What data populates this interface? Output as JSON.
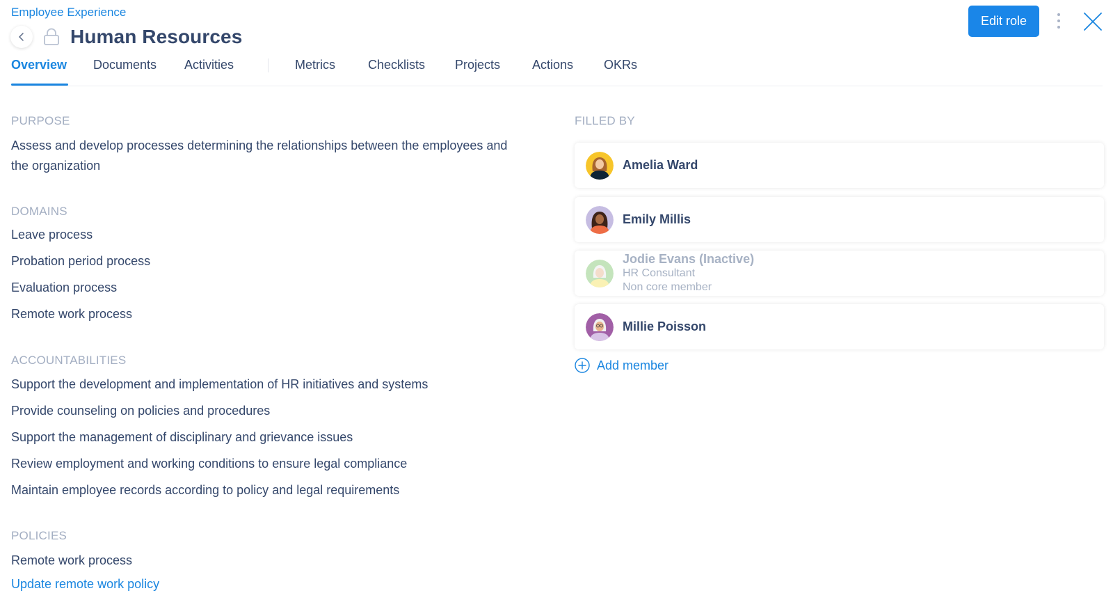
{
  "header": {
    "breadcrumb": "Employee Experience",
    "title": "Human Resources",
    "edit_label": "Edit role",
    "icons": {
      "back": "chevron-left-icon",
      "lock": "lock-icon",
      "more": "vertical-dots-icon",
      "close": "close-icon"
    }
  },
  "tabs": [
    {
      "label": "Overview",
      "active": true
    },
    {
      "label": "Documents",
      "active": false
    },
    {
      "label": "Activities",
      "active": false
    },
    {
      "label": "Metrics",
      "active": false
    },
    {
      "label": "Checklists",
      "active": false
    },
    {
      "label": "Projects",
      "active": false
    },
    {
      "label": "Actions",
      "active": false
    },
    {
      "label": "OKRs",
      "active": false
    }
  ],
  "purpose": {
    "label": "PURPOSE",
    "text": "Assess and develop processes determining the relationships between the employees and the organization"
  },
  "domains": {
    "label": "DOMAINS",
    "items": [
      "Leave process",
      "Probation period process",
      "Evaluation process",
      "Remote work process"
    ]
  },
  "accountabilities": {
    "label": "ACCOUNTABILITIES",
    "items": [
      "Support the development and implementation of HR initiatives and systems",
      "Provide counseling on policies and procedures",
      "Support the management of disciplinary and grievance issues",
      "Review employment and working conditions to ensure legal compliance",
      "Maintain employee records according to policy and legal requirements"
    ]
  },
  "policies": {
    "label": "POLICIES",
    "items": [
      "Remote work process"
    ],
    "link": "Update remote work policy"
  },
  "filled_by": {
    "label": "FILLED BY",
    "members": [
      {
        "name": "Amelia Ward",
        "status": "active"
      },
      {
        "name": "Emily Millis",
        "status": "active"
      },
      {
        "name": "Jodie Evans (Inactive)",
        "role": "HR Consultant",
        "membership": "Non core member",
        "status": "inactive"
      },
      {
        "name": "Millie Poisson",
        "status": "active"
      }
    ],
    "add_label": "Add member"
  },
  "colors": {
    "accent": "#1a86e8",
    "text": "#34476b",
    "muted": "#a3aec2"
  }
}
